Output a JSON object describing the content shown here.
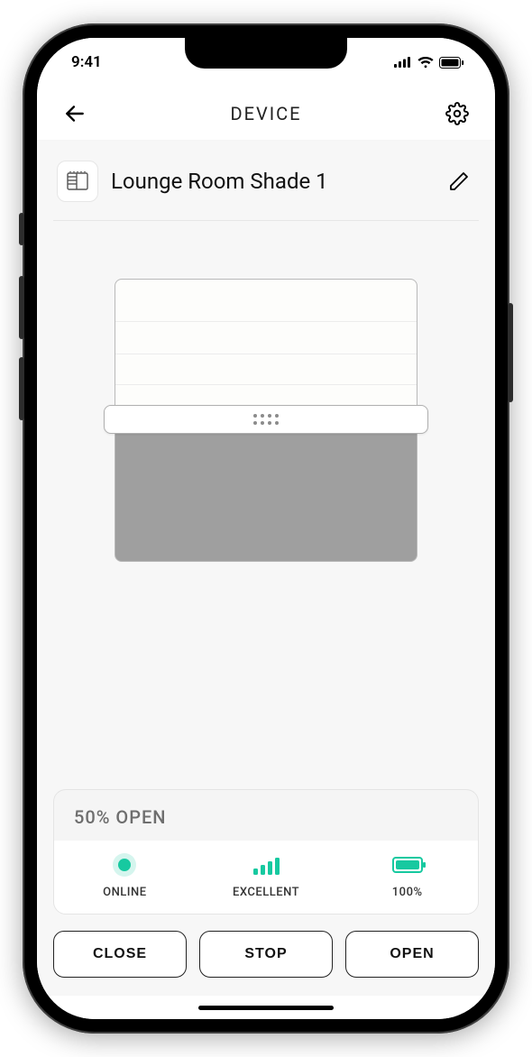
{
  "statusbar": {
    "time": "9:41"
  },
  "header": {
    "title": "DEVICE"
  },
  "device": {
    "name": "Lounge Room Shade 1",
    "open_percent": 50,
    "position_label": "50% OPEN"
  },
  "status": {
    "connection": {
      "label": "ONLINE"
    },
    "signal": {
      "label": "EXCELLENT"
    },
    "battery": {
      "label": "100%",
      "percent": 100
    }
  },
  "actions": {
    "close": "CLOSE",
    "stop": "STOP",
    "open": "OPEN"
  },
  "colors": {
    "accent": "#17c9a0"
  }
}
